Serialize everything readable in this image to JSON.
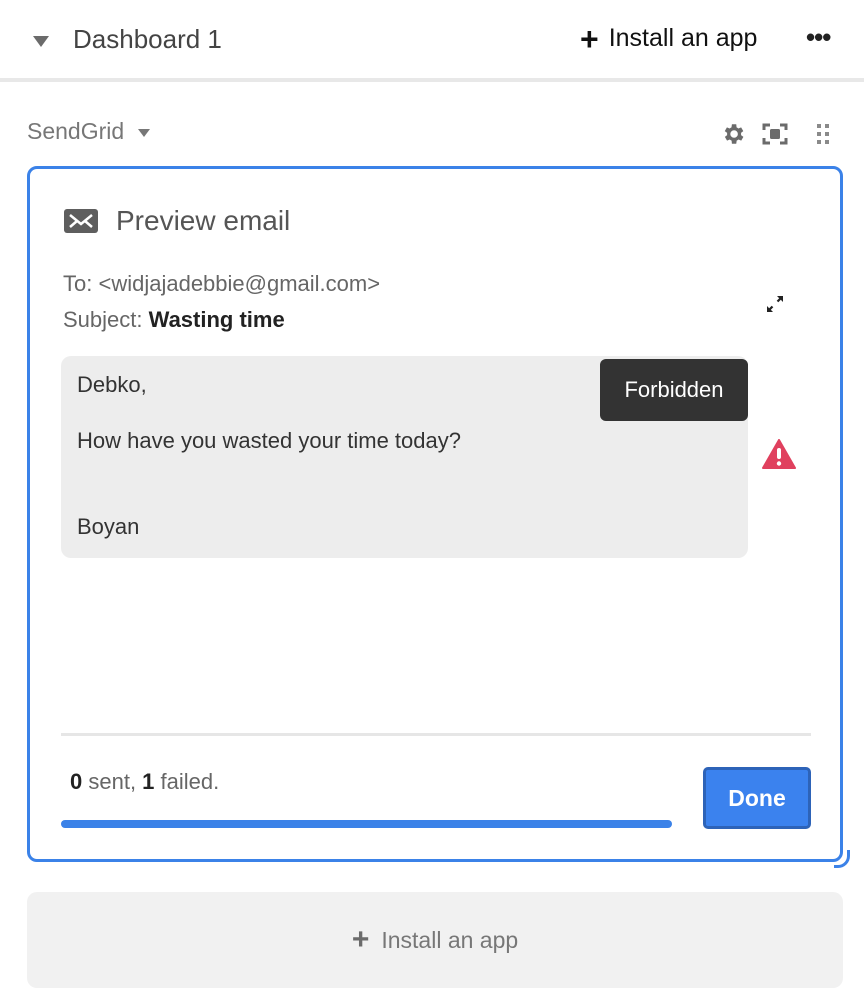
{
  "topbar": {
    "title": "Dashboard 1",
    "install_icon": "plus-icon",
    "install_label": "Install an app",
    "more_icon": "ellipsis-icon",
    "more_label": "•••"
  },
  "app": {
    "name": "SendGrid",
    "icons": [
      "gear-icon",
      "focus-icon",
      "drag-handle-icon"
    ]
  },
  "email": {
    "heading": "Preview email",
    "to_label": "To:",
    "to_value": "<widjajadebbie@gmail.com>",
    "subject_label": "Subject:",
    "subject_value": "Wasting time",
    "body_lines": [
      "Debko,",
      "How have you wasted your time today?",
      "Boyan"
    ],
    "tooltip": "Forbidden",
    "warning_icon": "warning-icon"
  },
  "status": {
    "sent_count": "0",
    "sent_label": " sent, ",
    "failed_count": "1",
    "failed_label": " failed.",
    "progress_percent": 100
  },
  "done_label": "Done",
  "install_card": {
    "label": "Install an app"
  },
  "colors": {
    "accent": "#3b82e8",
    "warning": "#e0405e",
    "tooltip_bg": "#333333"
  }
}
